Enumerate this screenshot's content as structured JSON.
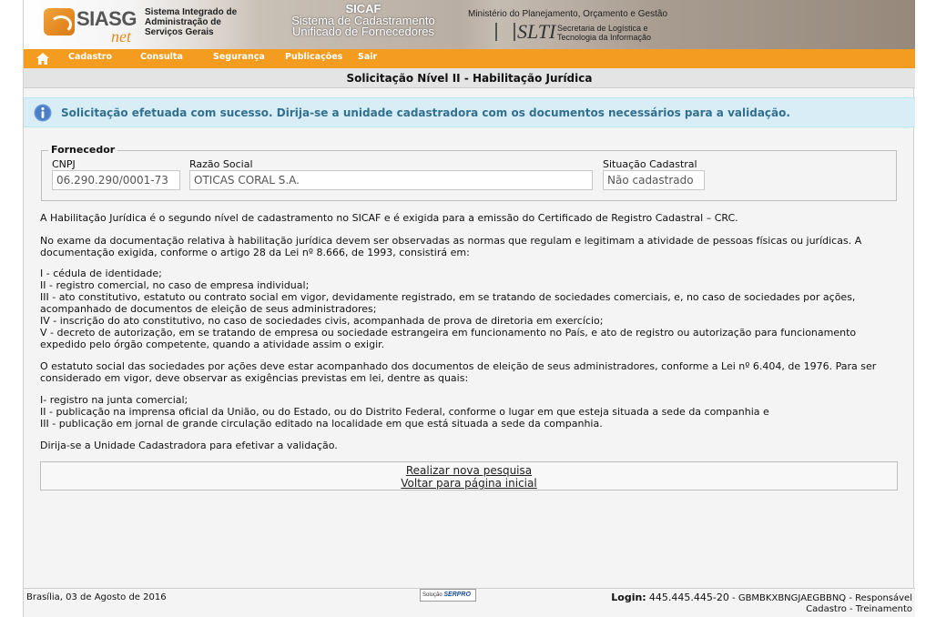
{
  "banner": {
    "logo_text": "SIASG",
    "logo_suffix": "net",
    "system_name": "Sistema Integrado de Administração de Serviços Gerais",
    "sicaf_title": "SICAF",
    "sicaf_subtitle": "Sistema de Cadastramento Unificado de Fornecedores",
    "ministry": "Ministério do Planejamento, Orçamento e Gestão",
    "slti_logo": "SLTI",
    "slti_description": "Secretaria de Logística e Tecnologia da Informação"
  },
  "menu": {
    "home_icon": "home-icon",
    "items": [
      {
        "label": "Cadastro"
      },
      {
        "label": "Consulta"
      },
      {
        "label": "Segurança"
      },
      {
        "label": "Publicações"
      },
      {
        "label": "Sair"
      }
    ]
  },
  "page_title": "Solicitação Nível II - Habilitação Jurídica",
  "info_message": {
    "icon": "info-icon",
    "text": "Solicitação efetuada com sucesso. Dirija-se a unidade cadastradora com os documentos necessários para a validação."
  },
  "fornecedor": {
    "legend": "Fornecedor",
    "cnpj_label": "CNPJ",
    "cnpj_value": "06.290.290/0001-73",
    "razao_label": "Razão Social",
    "razao_value": "OTICAS CORAL S.A.",
    "situacao_label": "Situação Cadastral",
    "situacao_value": "Não cadastrado"
  },
  "content": {
    "p1": "A Habilitação Jurídica é o segundo nível de cadastramento no SICAF e é exigida para a emissão do Certificado de Registro Cadastral – CRC.",
    "p2": "No exame da documentação relativa à habilitação jurídica devem ser observadas as normas que regulam e legitimam a atividade de pessoas físicas ou jurídicas. A documentação exigida, conforme o artigo 28 da Lei nº 8.666, de 1993, consistirá em:",
    "list1": [
      "I - cédula de identidade;",
      "II - registro comercial, no caso de empresa individual;",
      "III - ato constitutivo, estatuto ou contrato social em vigor, devidamente registrado, em se tratando de sociedades comerciais, e, no caso de sociedades por ações, acompanhado de documentos de eleição de seus administradores;",
      "IV - inscrição do ato constitutivo, no caso de sociedades civis, acompanhada de prova de diretoria em exercício;",
      "V - decreto de autorização, em se tratando de empresa ou sociedade estrangeira em funcionamento no País, e ato de registro ou autorização para funcionamento expedido pelo órgão competente, quando a atividade assim o exigir."
    ],
    "p3": "O estatuto social das sociedades por ações deve estar acompanhado dos documentos de eleição de seus administradores, conforme a Lei nº 6.404, de 1976. Para ser considerado em vigor, deve observar as exigências previstas em lei, dentre as quais:",
    "list2": [
      "I- registro na junta comercial;",
      "II - publicação na imprensa oficial da União, ou do Estado, ou do Distrito Federal, conforme o lugar em que esteja situada a sede da companhia e",
      "III - publicação em jornal de grande circulação editado na localidade em que está situada a sede da companhia."
    ],
    "p4": "Dirija-se a Unidade Cadastradora para efetivar a validação."
  },
  "links": {
    "new_search": "Realizar nova pesquisa",
    "home_page": "Voltar para página inicial"
  },
  "footer": {
    "date": "Brasília, 03 de Agosto de 2016",
    "serpro_prefix": "Solução",
    "serpro_logo": "SERPRO",
    "login_label": "Login:",
    "login_value": "445.445.445-20",
    "login_rest": "- GBMBKXBNGJAEGBBNQ - Responsável",
    "login_line2": "Cadastro - Treinamento"
  }
}
